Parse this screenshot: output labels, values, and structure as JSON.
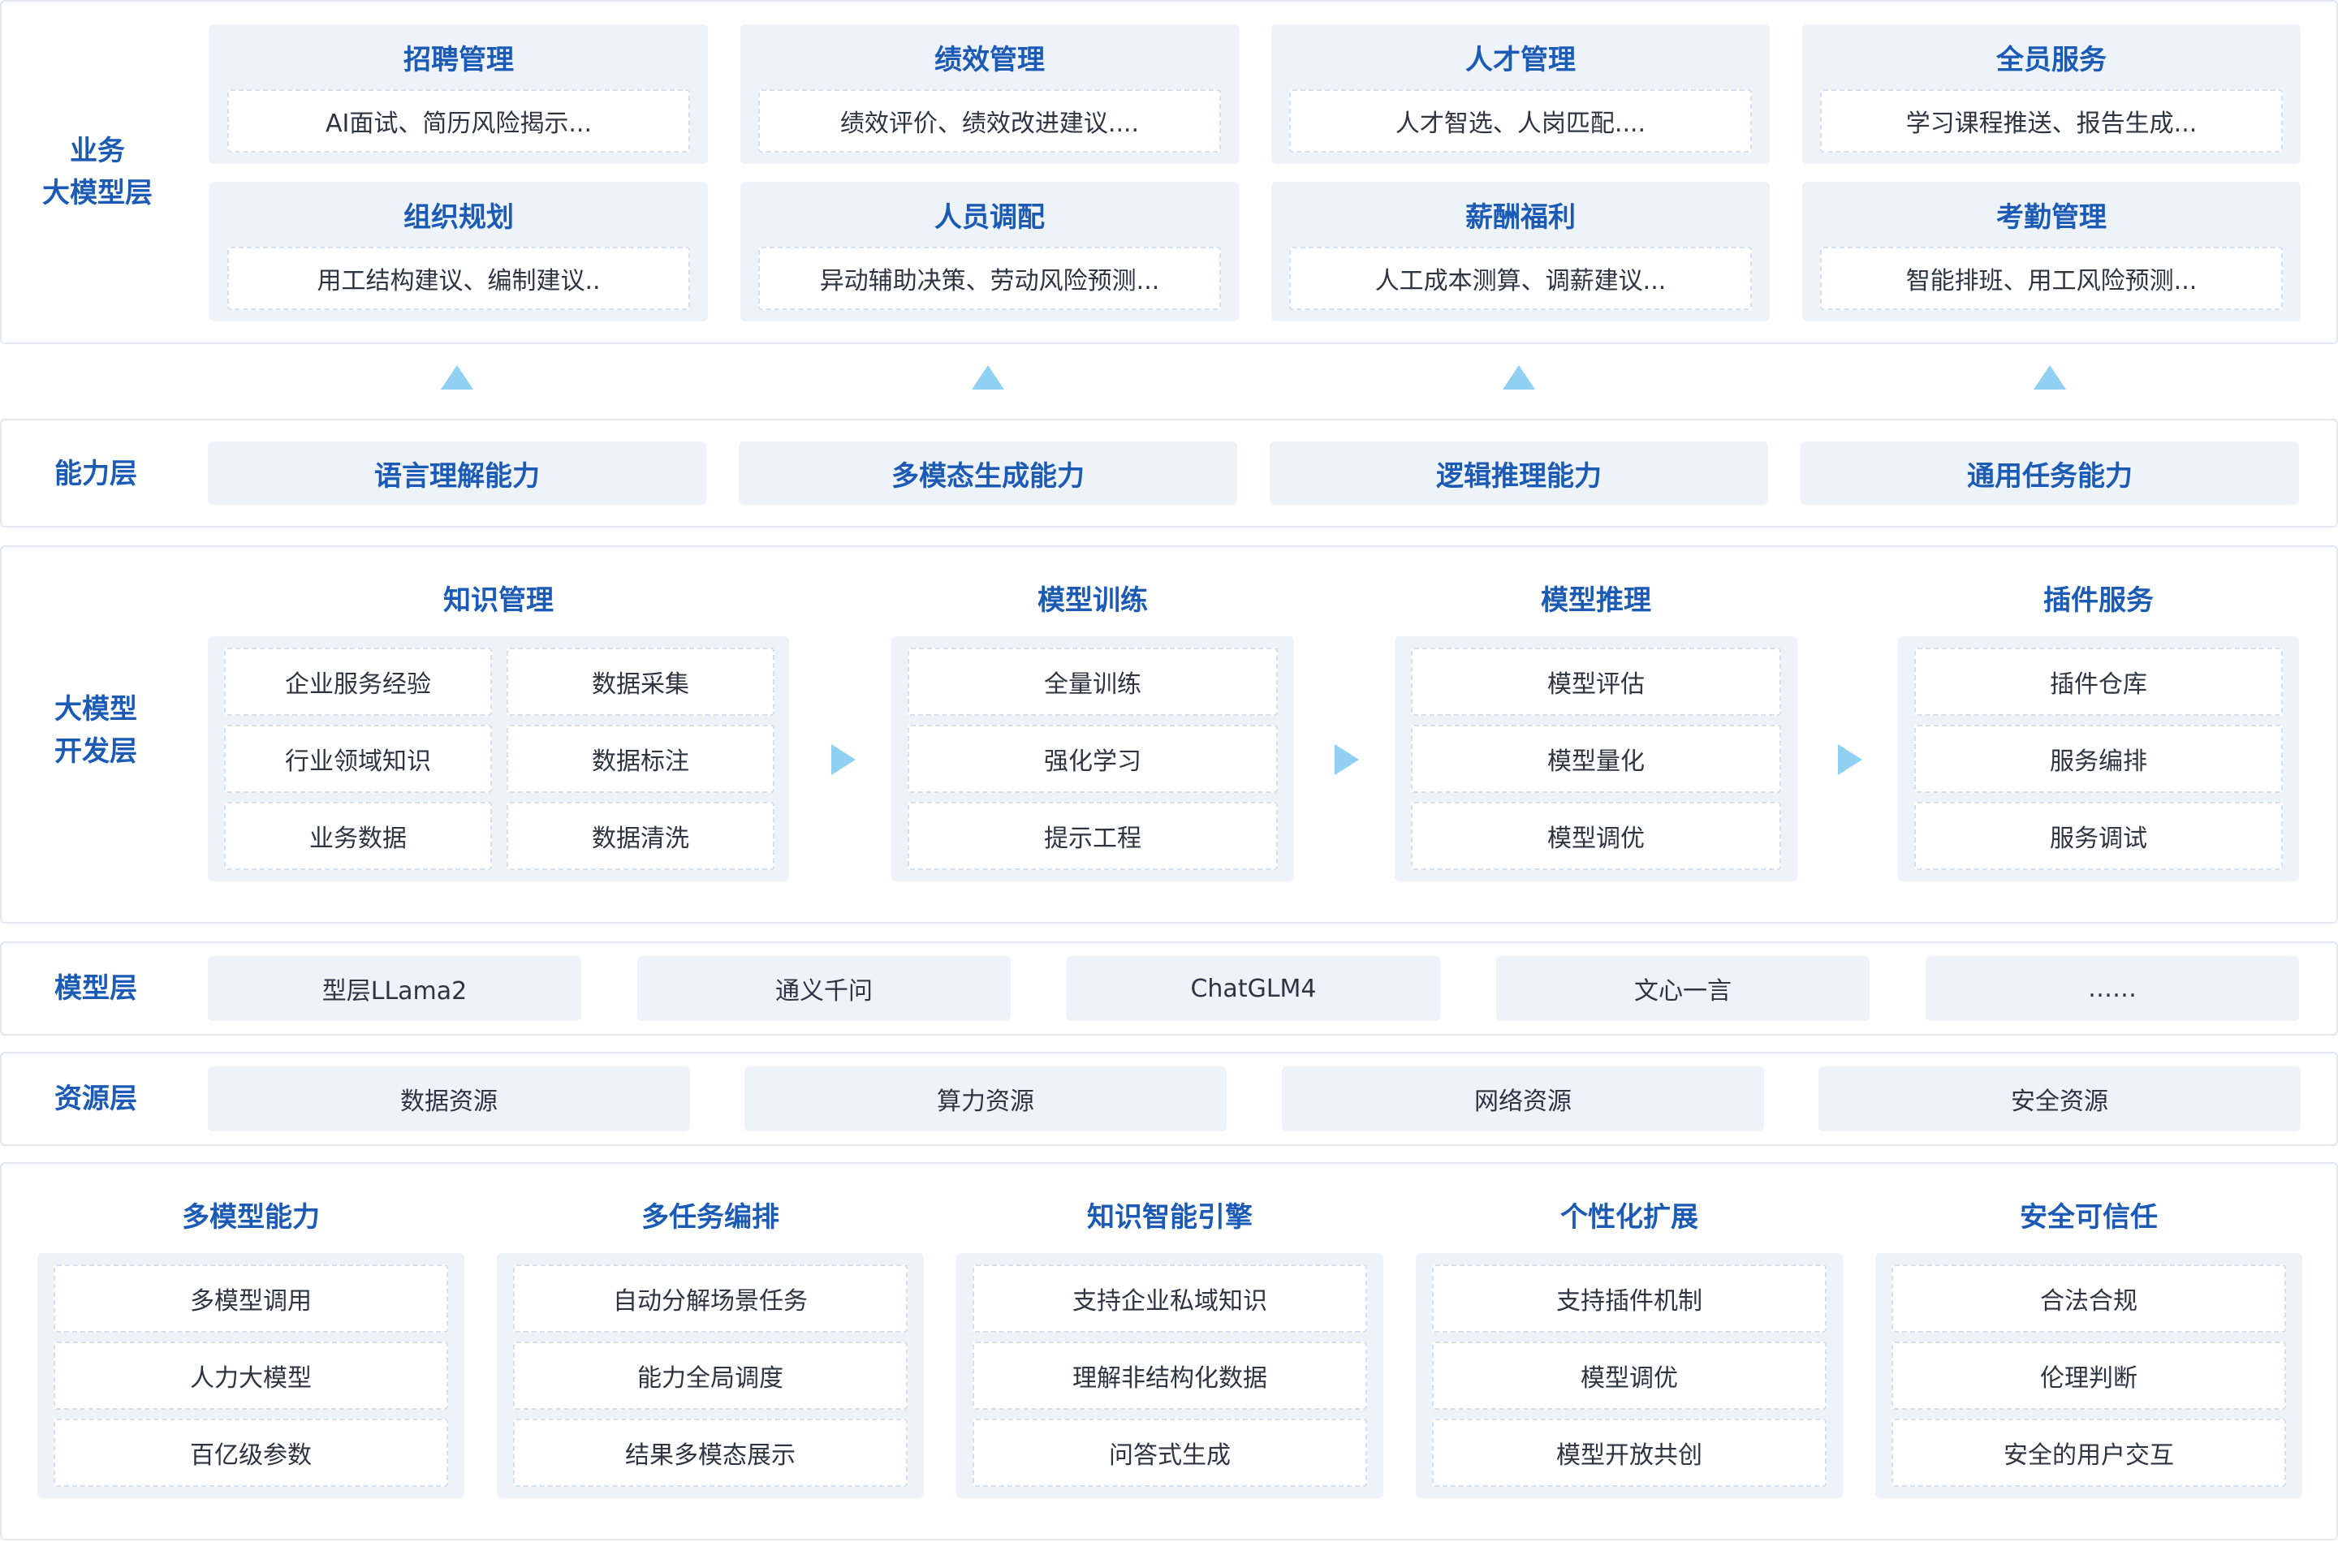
{
  "business_layer": {
    "label": "业务\n大模型层",
    "cards": [
      {
        "title": "招聘管理",
        "desc": "AI面试、简历风险揭示..."
      },
      {
        "title": "绩效管理",
        "desc": "绩效评价、绩效改进建议...."
      },
      {
        "title": "人才管理",
        "desc": "人才智选、人岗匹配...."
      },
      {
        "title": "全员服务",
        "desc": "学习课程推送、报告生成..."
      },
      {
        "title": "组织规划",
        "desc": "用工结构建议、编制建议.."
      },
      {
        "title": "人员调配",
        "desc": "异动辅助决策、劳动风险预测..."
      },
      {
        "title": "薪酬福利",
        "desc": "人工成本测算、调薪建议..."
      },
      {
        "title": "考勤管理",
        "desc": "智能排班、用工风险预测..."
      }
    ]
  },
  "capability_layer": {
    "label": "能力层",
    "items": [
      "语言理解能力",
      "多模态生成能力",
      "逻辑推理能力",
      "通用任务能力"
    ]
  },
  "dev_layer": {
    "label": "大模型\n开发层",
    "knowledge": {
      "title": "知识管理",
      "left": [
        "企业服务经验",
        "行业领域知识",
        "业务数据"
      ],
      "right": [
        "数据采集",
        "数据标注",
        "数据清洗"
      ]
    },
    "groups": [
      {
        "title": "模型训练",
        "items": [
          "全量训练",
          "强化学习",
          "提示工程"
        ]
      },
      {
        "title": "模型推理",
        "items": [
          "模型评估",
          "模型量化",
          "模型调优"
        ]
      },
      {
        "title": "插件服务",
        "items": [
          "插件仓库",
          "服务编排",
          "服务调试"
        ]
      }
    ]
  },
  "model_layer": {
    "label": "模型层",
    "items": [
      "型层LLama2",
      "通义千问",
      "ChatGLM4",
      "文心一言",
      "……"
    ]
  },
  "resource_layer": {
    "label": "资源层",
    "items": [
      "数据资源",
      "算力资源",
      "网络资源",
      "安全资源"
    ]
  },
  "features": [
    {
      "title": "多模型能力",
      "items": [
        "多模型调用",
        "人力大模型",
        "百亿级参数"
      ]
    },
    {
      "title": "多任务编排",
      "items": [
        "自动分解场景任务",
        "能力全局调度",
        "结果多模态展示"
      ]
    },
    {
      "title": "知识智能引擎",
      "items": [
        "支持企业私域知识",
        "理解非结构化数据",
        "问答式生成"
      ]
    },
    {
      "title": "个性化扩展",
      "items": [
        "支持插件机制",
        "模型调优",
        "模型开放共创"
      ]
    },
    {
      "title": "安全可信任",
      "items": [
        "合法合规",
        "伦理判断",
        "安全的用户交互"
      ]
    }
  ],
  "colors": {
    "accent": "#1b5bb5",
    "card_bg": "#eef3fa",
    "arrow": "#8fd0f3",
    "border": "#e4e9f1"
  }
}
